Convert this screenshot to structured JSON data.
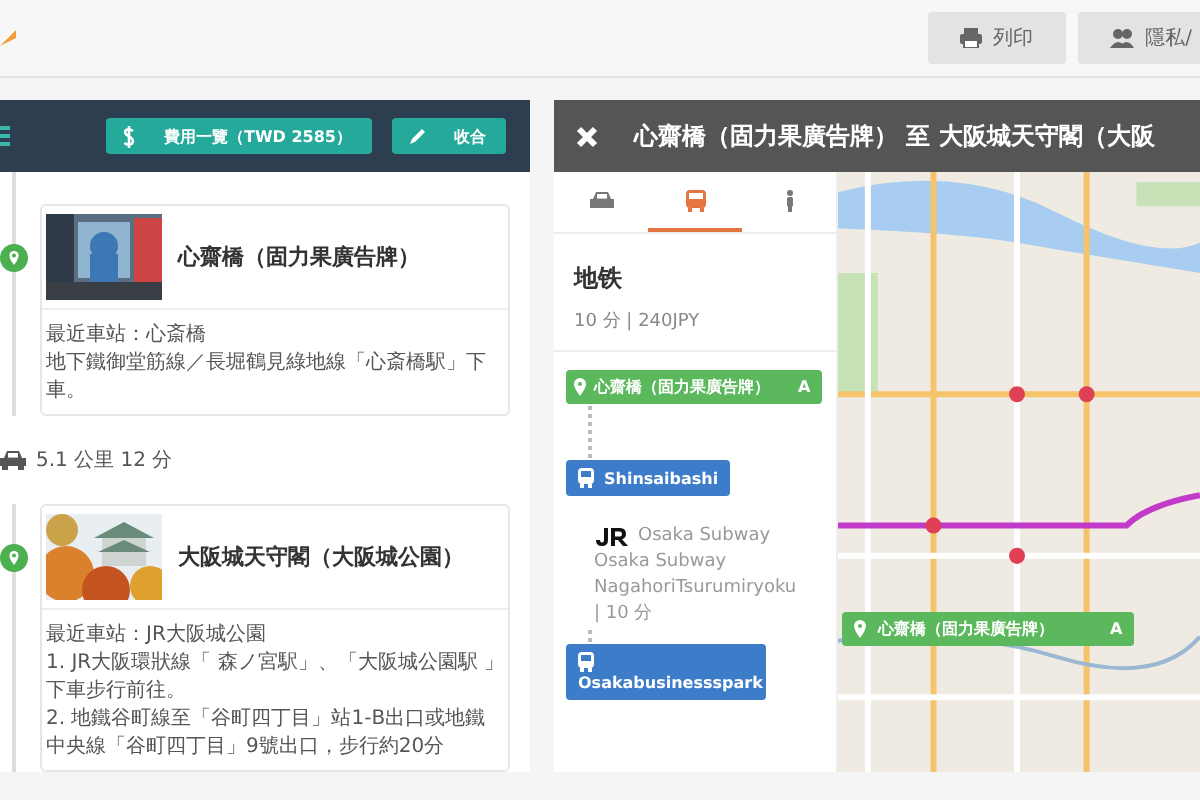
{
  "toolbar": {
    "buttons": [
      {
        "label": "列印"
      },
      {
        "label": "隱私/"
      }
    ]
  },
  "itinerary": {
    "buttons": [
      {
        "label": "費用一覽（TWD 2585）"
      },
      {
        "label": "收合"
      }
    ],
    "stops": [
      {
        "title": "心齋橋（固力果廣告牌）",
        "lines": [
          "最近車站：心斎橋",
          "地下鐵御堂筋線／長堀鶴見綠地線「心斎橋駅」下車。"
        ]
      },
      {
        "title": "大阪城天守閣（大阪城公園）",
        "lines": [
          "最近車站：JR大阪城公園",
          "1. JR大阪環狀線「 森ノ宮駅」、「大阪城公園駅 」下車步行前往。",
          "2. 地鐵谷町線至「谷町四丁目」站1-B出口或地鐵中央線「谷町四丁目」9號出口，步行約20分"
        ]
      }
    ],
    "legs": [
      {
        "text": "5.1 公里 12 分"
      }
    ]
  },
  "route": {
    "title": "心齋橋（固力果廣告牌） 至 大阪城天守閣（大阪",
    "modes": [
      {
        "kind": "car",
        "selected": false
      },
      {
        "kind": "transit",
        "selected": true
      },
      {
        "kind": "walk",
        "selected": false
      }
    ],
    "heading": "地铁",
    "summary": "10 分 | 240JPY",
    "steps": [
      {
        "kind": "place",
        "label": "心齋橋（固力果廣告牌）",
        "marker": "A"
      },
      {
        "kind": "station",
        "label": "Shinsaibashi"
      },
      {
        "kind": "ride",
        "operator": "Osaka Subway",
        "line": "Osaka Subway",
        "direction": "NagahoriTsurumiryoku",
        "duration": "| 10 分"
      },
      {
        "kind": "station",
        "label": "Osakabusinessspark"
      }
    ],
    "map_marker": {
      "label": "心齋橋（固力果廣告牌）",
      "marker": "A"
    }
  }
}
